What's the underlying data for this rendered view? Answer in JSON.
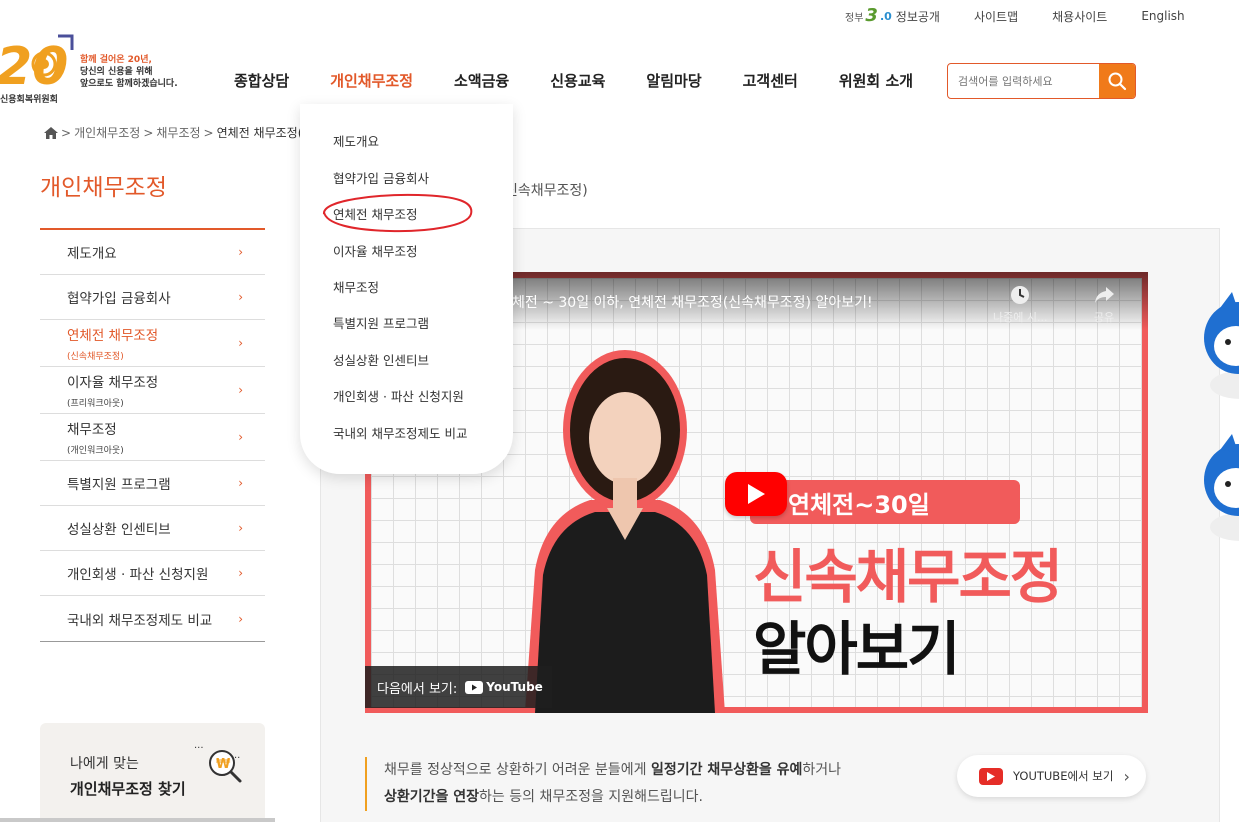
{
  "util": {
    "gov_small": "정부",
    "gov_number": "3",
    "gov_dot": ".0",
    "gov_label": "정보공개",
    "sitemap": "사이트맵",
    "recruit": "채용사이트",
    "english": "English"
  },
  "logo": {
    "number": "20",
    "slogan_l1": "함께 걸어온 20년,",
    "slogan_l2": "당신의 신용을 위해",
    "slogan_l3": "앞으로도 함께하겠습니다.",
    "org": "신용회복위원회"
  },
  "gnb": [
    "종합상담",
    "개인채무조정",
    "소액금융",
    "신용교육",
    "알림마당",
    "고객센터",
    "위원회 소개"
  ],
  "search": {
    "placeholder": "검색어를 입력하세요"
  },
  "breadcrumb": [
    "개인채무조정",
    "채무조정",
    "연체전 채무조정(신"
  ],
  "lnb": {
    "title": "개인채무조정",
    "items": [
      {
        "label": "제도개요",
        "sub": ""
      },
      {
        "label": "협약가입 금융회사",
        "sub": ""
      },
      {
        "label": "연체전 채무조정",
        "sub": "(신속채무조정)"
      },
      {
        "label": "이자율 채무조정",
        "sub": "(프리워크아웃)"
      },
      {
        "label": "채무조정",
        "sub": "(개인워크아웃)"
      },
      {
        "label": "특별지원 프로그램",
        "sub": ""
      },
      {
        "label": "성실상환 인센티브",
        "sub": ""
      },
      {
        "label": "개인회생 · 파산 신청지원",
        "sub": ""
      },
      {
        "label": "국내외 채무조정제도 비교",
        "sub": ""
      }
    ],
    "arrow": "›"
  },
  "finder": {
    "line1": "나에게 맞는",
    "line2": "개인채무조정 찾기",
    "won": "₩"
  },
  "content": {
    "page_sub": "신속채무조정)",
    "video": {
      "title": "체전 ~ 30일 이하, 연체전 채무조정(신속채무조정) 알아보기!",
      "later": "나중에 시...",
      "share": "공유",
      "tag": "연체전~30일",
      "big1": "신속채무조정",
      "big2": "알아보기",
      "watch_on": "다음에서 보기:",
      "youtube": "YouTube"
    },
    "desc": {
      "p1a": "채무를 정상적으로 상환하기 어려운 분들에게 ",
      "p1b": "일정기간 채무상환을 유예",
      "p1c": "하거나",
      "p2a": "상환기간을 연장",
      "p2b": "하는 등의 채무조정을 지원해드립니다."
    },
    "yt_button": "YOUTUBE에서 보기",
    "yt_arrow": "›"
  },
  "dropdown": [
    "제도개요",
    "협약가입 금융회사",
    "연체전 채무조정",
    "이자율 채무조정",
    "채무조정",
    "특별지원 프로그램",
    "성실상환 인센티브",
    "개인회생 · 파산 신청지원",
    "국내외 채무조정제도 비교"
  ],
  "colors": {
    "accent": "#e2592a",
    "orange_btn": "#f07a1a",
    "video_red": "#f15b5b",
    "youtube": "#ff0000",
    "annotation": "#e0262b"
  }
}
